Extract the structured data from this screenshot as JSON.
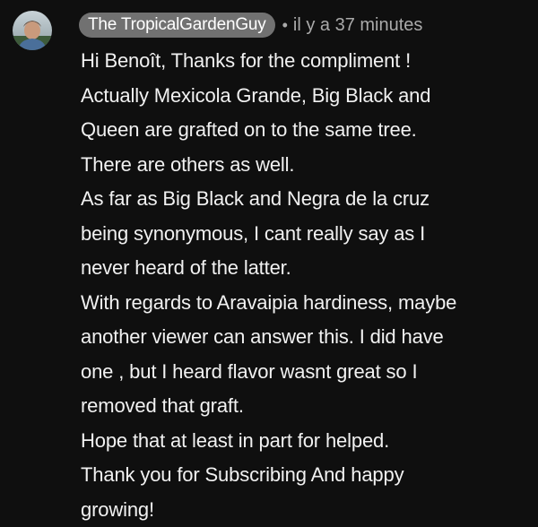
{
  "comment": {
    "avatar_icon": "user-avatar-photo",
    "author": "The TropicalGardenGuy",
    "separator": "•",
    "timestamp": "il y a 37 minutes",
    "lines": [
      "Hi Benoît, Thanks for the compliment !",
      "Actually Mexicola Grande, Big Black and",
      "Queen are grafted on to the same tree.",
      "There are others as well.",
      "As far as Big Black and Negra de la cruz",
      "being synonymous, I cant really say as I",
      "never heard of the latter.",
      "With regards to Aravaipia hardiness, maybe",
      "another viewer can answer this. I did have",
      "one , but I heard flavor wasnt great so I",
      "removed that graft.",
      "Hope that at least in part for helped.",
      "Thank you for Subscribing And happy",
      "growing!"
    ]
  },
  "colors": {
    "background": "#0f0f0f",
    "author_chip": "#717171",
    "text": "#f1f1f1",
    "muted": "#aaaaaa"
  }
}
